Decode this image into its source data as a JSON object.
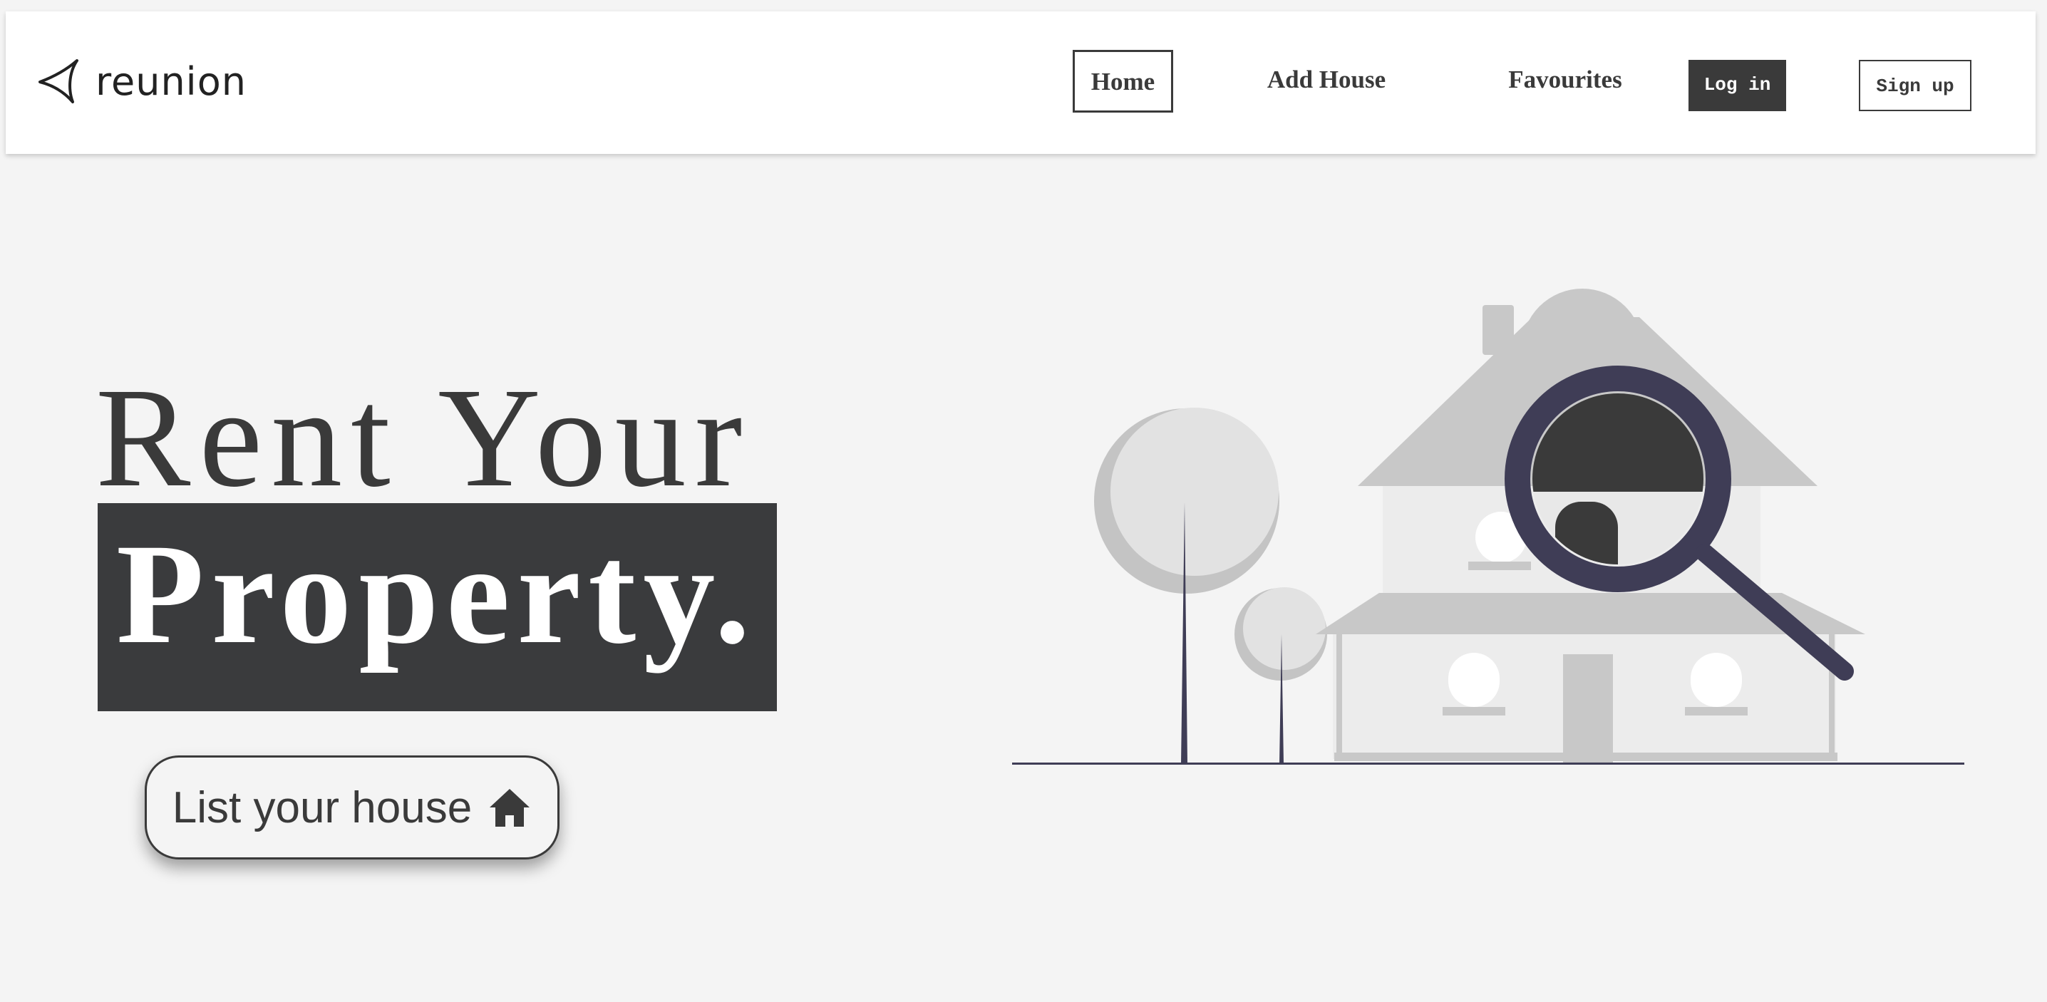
{
  "navbar": {
    "logo_text": "reunion",
    "links": [
      {
        "label": "Home",
        "active": true
      },
      {
        "label": "Add House",
        "active": false
      },
      {
        "label": "Favourites",
        "active": false
      }
    ],
    "login_label": "Log in",
    "signup_label": "Sign up"
  },
  "hero": {
    "line1": "Rent Your",
    "line2": "Property.",
    "cta_label": "List your house",
    "cta_icon": "home-icon"
  },
  "illustration": {
    "icons": [
      "house-illustration",
      "tree-icon",
      "magnifying-glass-icon"
    ]
  },
  "colors": {
    "background": "#f4f4f4",
    "dark": "#3a3a3a",
    "accent_navy": "#3f3d56",
    "navbar": "#ffffff"
  }
}
